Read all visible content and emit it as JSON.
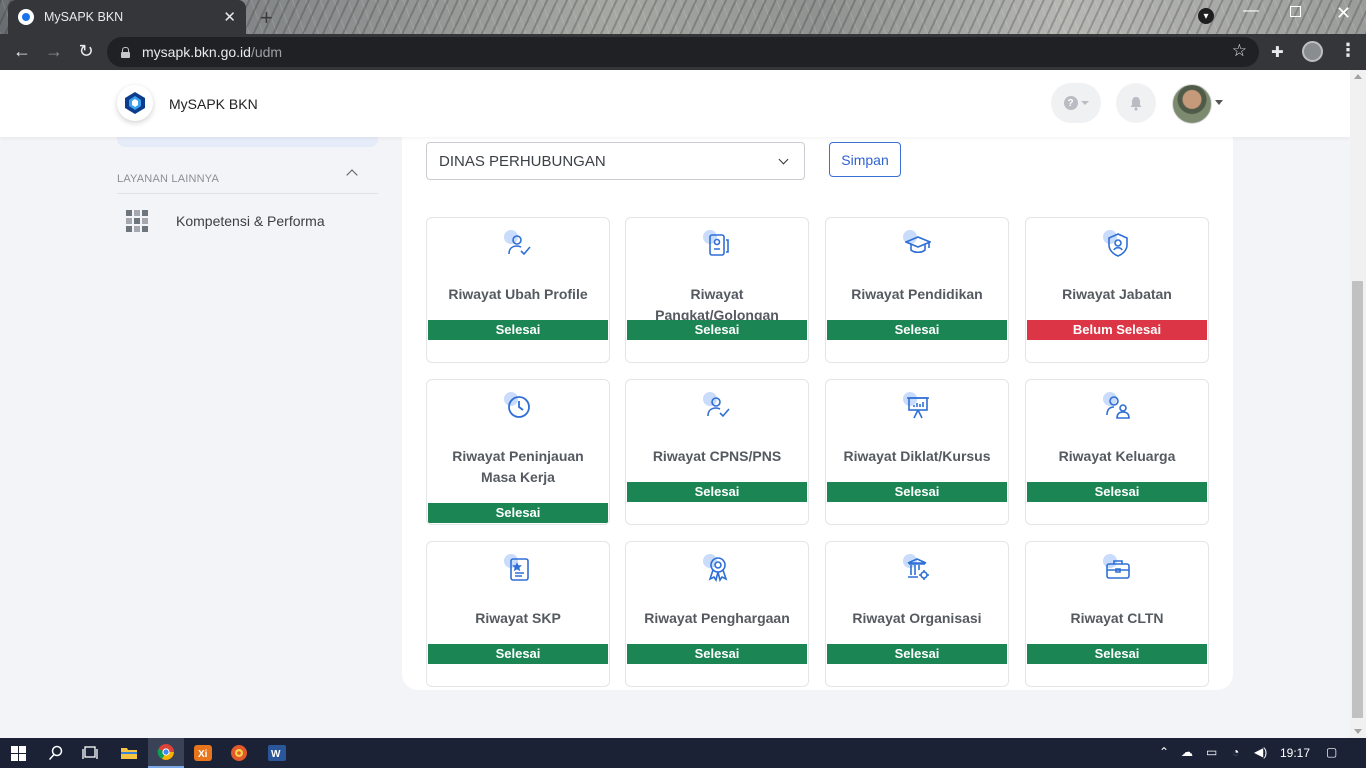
{
  "browser": {
    "tab_title": "MySAPK BKN",
    "url_host": "mysapk.bkn.go.id",
    "url_path": "/udm"
  },
  "header": {
    "brand": "MySAPK BKN",
    "help_icon": "question-icon",
    "notification_icon": "bell-icon"
  },
  "sidebar": {
    "section_label": "LAYANAN LAINNYA",
    "items": [
      {
        "label": "Kompetensi & Performa",
        "icon": "grid-icon"
      }
    ]
  },
  "main": {
    "unit_select": {
      "value": "DINAS PERHUBUNGAN"
    },
    "save_label": "Simpan",
    "tiles": [
      {
        "title": "Riwayat Ubah Profile",
        "status": "Selesai",
        "icon": "user-check-icon"
      },
      {
        "title": "Riwayat Pangkat/Golongan",
        "status": "Selesai",
        "icon": "id-card-icon"
      },
      {
        "title": "Riwayat Pendidikan",
        "status": "Selesai",
        "icon": "graduation-cap-icon"
      },
      {
        "title": "Riwayat Jabatan",
        "status": "Belum Selesai",
        "icon": "badge-shield-icon"
      },
      {
        "title": "Riwayat Peninjauan Masa Kerja",
        "status": "Selesai",
        "icon": "clock-icon"
      },
      {
        "title": "Riwayat CPNS/PNS",
        "status": "Selesai",
        "icon": "user-check-icon"
      },
      {
        "title": "Riwayat Diklat/Kursus",
        "status": "Selesai",
        "icon": "presentation-board-icon"
      },
      {
        "title": "Riwayat Keluarga",
        "status": "Selesai",
        "icon": "family-icon"
      },
      {
        "title": "Riwayat SKP",
        "status": "Selesai",
        "icon": "document-star-icon"
      },
      {
        "title": "Riwayat Penghargaan",
        "status": "Selesai",
        "icon": "award-medal-icon"
      },
      {
        "title": "Riwayat Organisasi",
        "status": "Selesai",
        "icon": "building-gear-icon"
      },
      {
        "title": "Riwayat CLTN",
        "status": "Selesai",
        "icon": "briefcase-icon"
      }
    ]
  },
  "colors": {
    "done": "#1b8654",
    "not_done": "#dc3545",
    "accent": "#2f63cf",
    "icon_blue": "#2f6fd6"
  },
  "taskbar": {
    "clock": "19:17"
  }
}
